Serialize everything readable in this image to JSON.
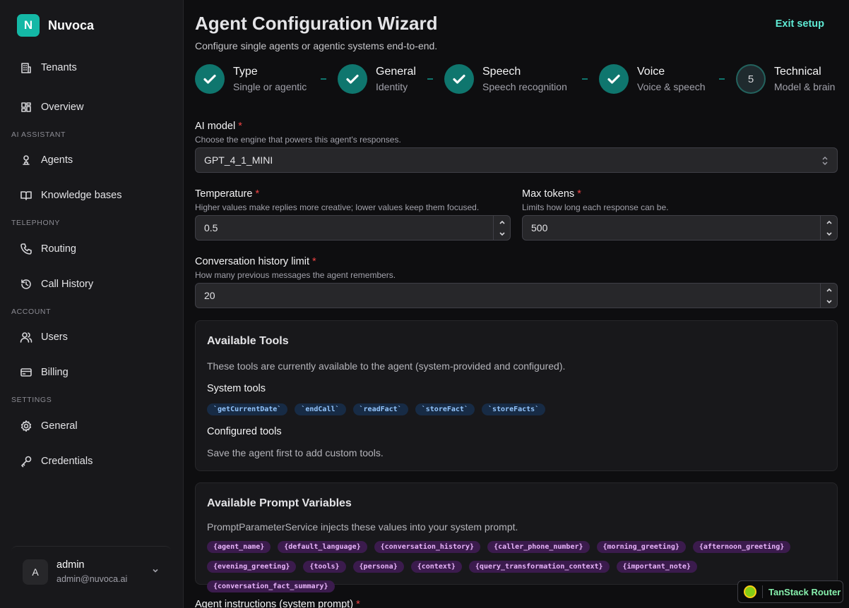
{
  "brand": {
    "logo_letter": "N",
    "name": "Nuvoca"
  },
  "sidebar": {
    "top_items": [
      {
        "label": "Tenants",
        "icon": "building-icon"
      },
      {
        "label": "Overview",
        "icon": "dashboard-icon"
      }
    ],
    "sections": [
      {
        "label": "AI ASSISTANT",
        "items": [
          {
            "label": "Agents",
            "icon": "bot-icon"
          },
          {
            "label": "Knowledge bases",
            "icon": "book-icon"
          }
        ]
      },
      {
        "label": "TELEPHONY",
        "items": [
          {
            "label": "Routing",
            "icon": "phone-icon"
          },
          {
            "label": "Call History",
            "icon": "history-icon"
          }
        ]
      },
      {
        "label": "ACCOUNT",
        "items": [
          {
            "label": "Users",
            "icon": "users-icon"
          },
          {
            "label": "Billing",
            "icon": "credit-card-icon"
          }
        ]
      },
      {
        "label": "SETTINGS",
        "items": [
          {
            "label": "General",
            "icon": "gear-icon"
          },
          {
            "label": "Credentials",
            "icon": "key-icon"
          }
        ]
      }
    ],
    "user": {
      "initial": "A",
      "name": "admin",
      "email": "admin@nuvoca.ai"
    }
  },
  "header": {
    "title": "Agent Configuration Wizard",
    "subtitle": "Configure single agents or agentic systems end-to-end.",
    "exit_label": "Exit setup"
  },
  "steps": [
    {
      "title": "Type",
      "sub": "Single or agentic",
      "status": "complete"
    },
    {
      "title": "General",
      "sub": "Identity",
      "status": "complete"
    },
    {
      "title": "Speech",
      "sub": "Speech recognition",
      "status": "complete"
    },
    {
      "title": "Voice",
      "sub": "Voice & speech",
      "status": "complete"
    },
    {
      "title": "Technical",
      "sub": "Model & brain",
      "status": "current",
      "number": "5"
    }
  ],
  "form": {
    "model": {
      "label": "AI model",
      "help": "Choose the engine that powers this agent's responses.",
      "value": "GPT_4_1_MINI"
    },
    "temperature": {
      "label": "Temperature",
      "help": "Higher values make replies more creative; lower values keep them focused.",
      "value": "0.5"
    },
    "max_tokens": {
      "label": "Max tokens",
      "help": "Limits how long each response can be.",
      "value": "500"
    },
    "history": {
      "label": "Conversation history limit",
      "help": "How many previous messages the agent remembers.",
      "value": "20"
    },
    "required_mark": "*"
  },
  "tools_card": {
    "title": "Available Tools",
    "desc": "These tools are currently available to the agent (system-provided and configured).",
    "system_label": "System tools",
    "system_tools": [
      "`getCurrentDate`",
      "`endCall`",
      "`readFact`",
      "`storeFact`",
      "`storeFacts`"
    ],
    "configured_label": "Configured tools",
    "configured_empty": "Save the agent first to add custom tools."
  },
  "vars_card": {
    "title": "Available Prompt Variables",
    "desc": "PromptParameterService injects these values into your system prompt.",
    "variables": [
      "{agent_name}",
      "{default_language}",
      "{conversation_history}",
      "{caller_phone_number}",
      "{morning_greeting}",
      "{afternoon_greeting}",
      "{evening_greeting}",
      "{tools}",
      "{persona}",
      "{context}",
      "{query_transformation_context}",
      "{important_note}",
      "{conversation_fact_summary}"
    ]
  },
  "bottom_field": {
    "label": "Agent instructions (system prompt)"
  },
  "devtools": {
    "label": "TanStack Router"
  },
  "colors": {
    "accent": "#14b8a6",
    "accent_text": "#5eead4",
    "step_done": "#0f766e",
    "required": "#ef4444"
  }
}
